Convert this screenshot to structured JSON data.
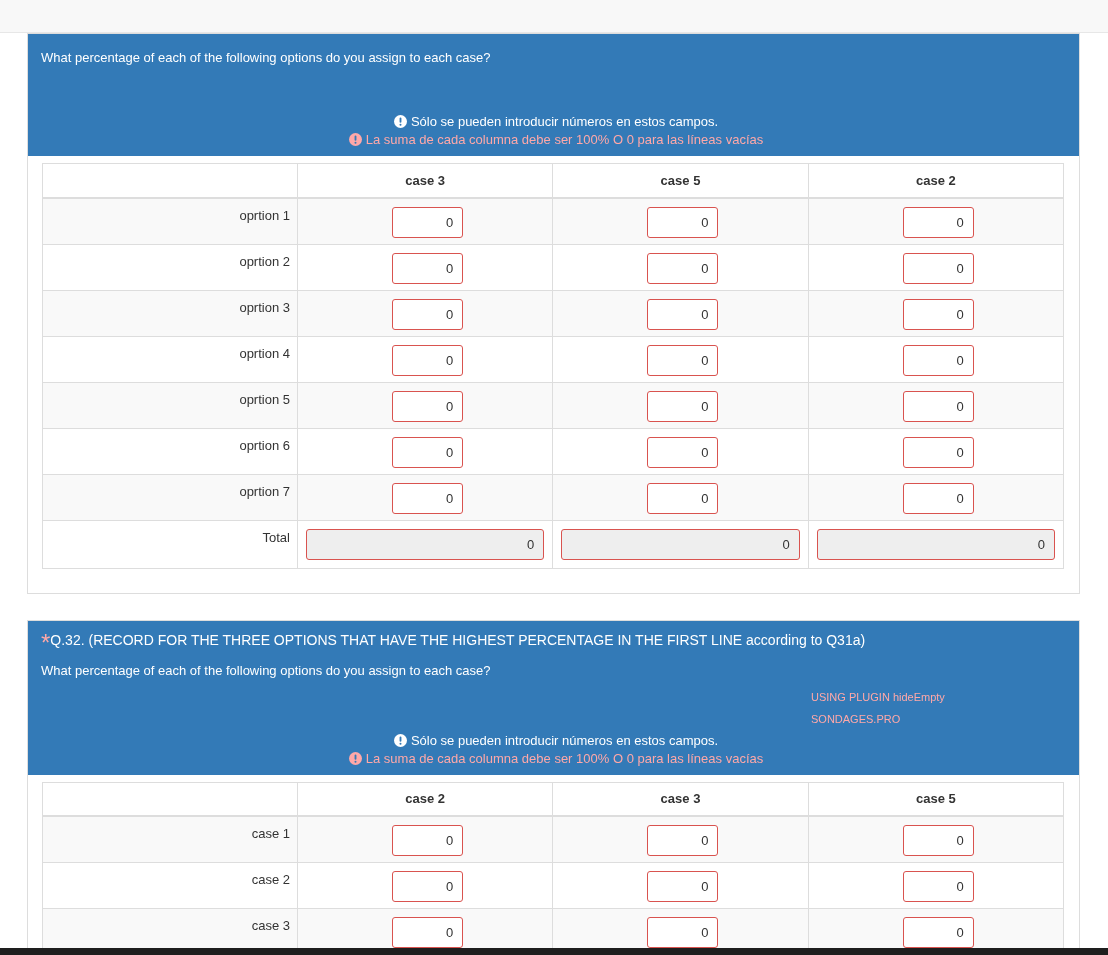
{
  "questions": [
    {
      "question": "What percentage of each of the following options do you assign to each case?",
      "notes": [
        {
          "kind": "info",
          "text": "Sólo se pueden introducir números en estos campos."
        },
        {
          "kind": "error",
          "text": "La suma de cada columna debe ser 100% O 0 para las líneas vacías"
        }
      ],
      "columns": [
        "case 3",
        "case 5",
        "case 2"
      ],
      "rows": [
        {
          "label": "oprtion 1",
          "values": [
            "0",
            "0",
            "0"
          ]
        },
        {
          "label": "oprtion 2",
          "values": [
            "0",
            "0",
            "0"
          ]
        },
        {
          "label": "oprtion 3",
          "values": [
            "0",
            "0",
            "0"
          ]
        },
        {
          "label": "oprtion 4",
          "values": [
            "0",
            "0",
            "0"
          ]
        },
        {
          "label": "oprtion 5",
          "values": [
            "0",
            "0",
            "0"
          ]
        },
        {
          "label": "oprtion 6",
          "values": [
            "0",
            "0",
            "0"
          ]
        },
        {
          "label": "oprtion 7",
          "values": [
            "0",
            "0",
            "0"
          ]
        }
      ],
      "total": {
        "label": "Total",
        "values": [
          "0",
          "0",
          "0"
        ]
      }
    },
    {
      "required_mark": "*",
      "title": "Q.32. (RECORD FOR THE THREE OPTIONS THAT HAVE THE HIGHEST PERCENTAGE IN THE FIRST LINE according to Q31a)",
      "question": "What percentage of each of the following options do you assign to each case?",
      "plugin_notes": [
        "USING PLUGIN hideEmpty",
        "SONDAGES.PRO"
      ],
      "notes": [
        {
          "kind": "info",
          "text": "Sólo se pueden introducir números en estos campos."
        },
        {
          "kind": "error",
          "text": "La suma de cada columna debe ser 100% O 0 para las líneas vacías"
        }
      ],
      "columns": [
        "case 2",
        "case 3",
        "case 5"
      ],
      "rows": [
        {
          "label": "case 1",
          "values": [
            "0",
            "0",
            "0"
          ]
        },
        {
          "label": "case 2",
          "values": [
            "0",
            "0",
            "0"
          ]
        },
        {
          "label": "case 3",
          "values": [
            "0",
            "0",
            "0"
          ]
        }
      ]
    }
  ]
}
